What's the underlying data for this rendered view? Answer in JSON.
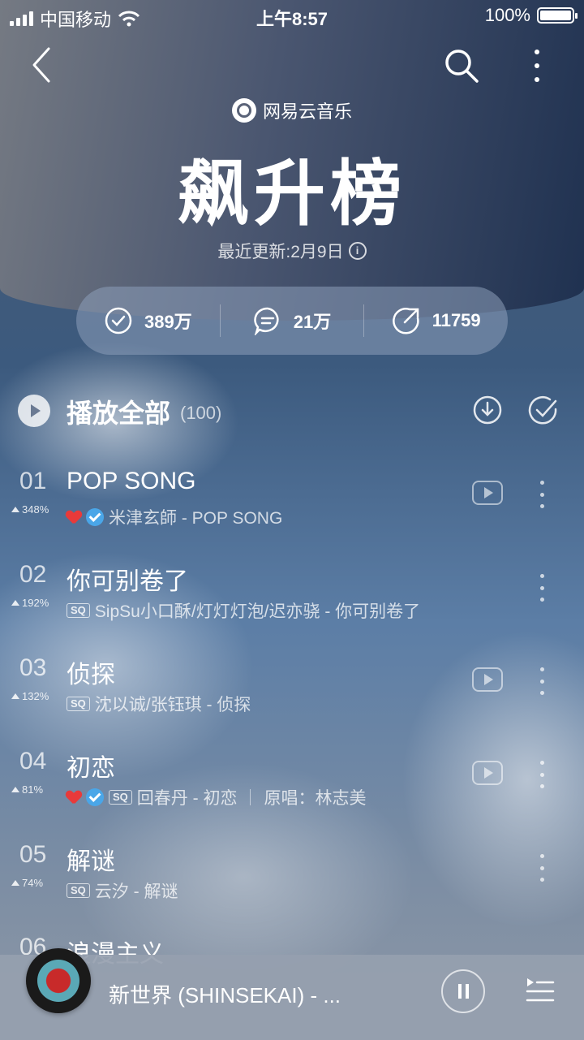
{
  "status_bar": {
    "carrier": "中国移动",
    "time": "上午8:57",
    "battery": "100%"
  },
  "header": {
    "brand": "网易云音乐",
    "title": "飙升榜",
    "update": "最近更新:2月9日"
  },
  "stats": {
    "subscribed": "389万",
    "comments": "21万",
    "shares": "11759"
  },
  "play_all": {
    "label": "播放全部",
    "count": "(100)"
  },
  "songs": [
    {
      "rank": "01",
      "trend": "348%",
      "title": "POP SONG",
      "meta": "米津玄師 - POP SONG",
      "heart": true,
      "verified": true,
      "sq": false,
      "mv": true
    },
    {
      "rank": "02",
      "trend": "192%",
      "title": "你可别卷了",
      "meta": "SipSu小口酥/灯灯灯泡/迟亦骁 - 你可别卷了",
      "heart": false,
      "verified": false,
      "sq": true,
      "mv": false
    },
    {
      "rank": "03",
      "trend": "132%",
      "title": "侦探",
      "meta": "沈以诚/张钰琪 - 侦探",
      "heart": false,
      "verified": false,
      "sq": true,
      "mv": true
    },
    {
      "rank": "04",
      "trend": "81%",
      "title": "初恋",
      "meta": "回春丹 - 初恋",
      "extra": "原唱：林志美",
      "heart": true,
      "verified": true,
      "sq": true,
      "mv": true
    },
    {
      "rank": "05",
      "trend": "74%",
      "title": "解谜",
      "meta": "云汐 - 解谜",
      "heart": false,
      "verified": false,
      "sq": true,
      "mv": false
    },
    {
      "rank": "06",
      "title": "浪漫主义"
    }
  ],
  "sq_label": "SQ",
  "player": {
    "title": "新世界 (SHINSEKAI) - ..."
  },
  "icons": [
    "back-icon",
    "search-icon",
    "more-icon",
    "netease-logo-icon",
    "info-icon",
    "subscribe-check-icon",
    "comment-icon",
    "share-icon",
    "play-icon",
    "download-icon",
    "multi-select-icon",
    "heart-icon",
    "verified-icon",
    "mv-icon",
    "pause-icon",
    "playlist-icon"
  ]
}
